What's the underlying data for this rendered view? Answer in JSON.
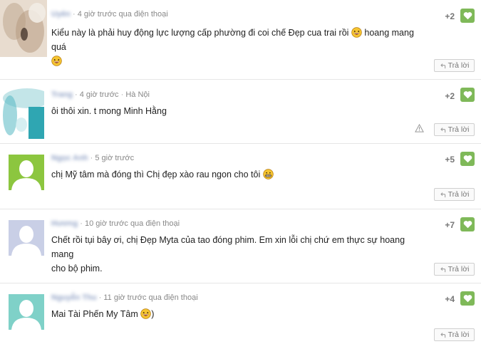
{
  "comments": [
    {
      "name": "Uyên",
      "time": "4 giờ trước qua điện thoại",
      "text": "Kiểu này là phải huy động lực lượng cấp phường đi coi chế Đẹp cua trai rồi",
      "text_tail": "hoang mang quá",
      "score": "+2",
      "reply_label": "Trả lời"
    },
    {
      "name": "Trang",
      "time": "4 giờ trước",
      "location": "Hà Nội",
      "text": "ôi thôi xin. t mong Minh Hằng",
      "score": "+2",
      "reply_label": "Trả lời"
    },
    {
      "name": "Ngọc Anh",
      "time": "5 giờ trước",
      "text": "chị Mỹ tâm mà đóng thì Chị đẹp xào rau ngon cho tôi",
      "score": "+5",
      "reply_label": "Trả lời"
    },
    {
      "name": "Hương",
      "time": "10 giờ trước qua điện thoại",
      "text_line1": "Chết rồi tụi bây ơi, chị Đẹp Myta của tao đóng phim. Em xin lỗi chị chứ em thực sự hoang mang",
      "text_line2": "cho bộ phim.",
      "score": "+7",
      "reply_label": "Trả lời"
    },
    {
      "name": "Nguyễn Thu",
      "time": "11 giờ trước qua điện thoại",
      "text": "Mai Tài Phến My Tâm",
      "text_tail": ")",
      "score": "+4",
      "reply_label": "Trả lời"
    }
  ],
  "colors": {
    "like_button": "#7fb959",
    "avatar_green": "#8cc63f",
    "avatar_teal": "#7fd1c8",
    "avatar_lavender": "#c9cfe6",
    "name_link": "#3b5998"
  },
  "icons": {
    "like": "heart-icon",
    "reply": "reply-arrow-icon",
    "warning": "warning-triangle-icon",
    "emoji_laugh": "laughing-emoji-icon",
    "emoji_grin": "grinning-emoji-icon"
  }
}
